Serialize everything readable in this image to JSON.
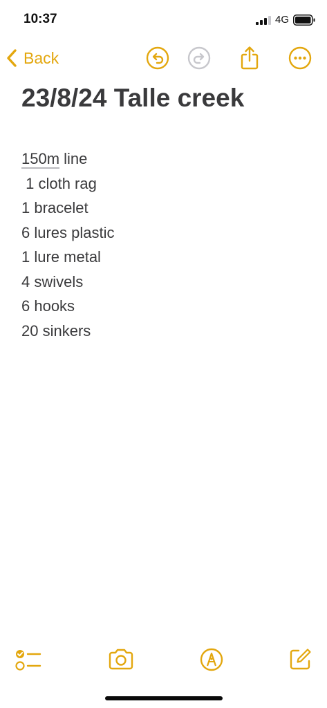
{
  "status_bar": {
    "time": "10:37",
    "network": "4G",
    "signal_bars_active": 3,
    "signal_bars_total": 4
  },
  "toolbar": {
    "back_label": "Back",
    "icons": {
      "undo": "undo-icon",
      "redo": "redo-icon",
      "share": "share-icon",
      "more": "more-icon"
    },
    "redo_enabled": false
  },
  "note": {
    "title": "23/8/24 Talle creek",
    "lines": [
      {
        "prefix": "150m",
        "text": " line"
      },
      {
        "prefix": "",
        "text": " 1 cloth rag"
      },
      {
        "prefix": "",
        "text": "1 bracelet"
      },
      {
        "prefix": "",
        "text": "6 lures plastic"
      },
      {
        "prefix": "",
        "text": "1 lure metal"
      },
      {
        "prefix": "",
        "text": "4 swivels"
      },
      {
        "prefix": "",
        "text": "6 hooks"
      },
      {
        "prefix": "",
        "text": "20 sinkers"
      }
    ]
  },
  "bottom_bar": {
    "icons": {
      "checklist": "checklist-icon",
      "camera": "camera-icon",
      "markup": "markup-pen-icon",
      "compose": "compose-icon"
    }
  },
  "colors": {
    "accent": "#E3A70E",
    "text": "#3a3a3c",
    "disabled": "#c7c7cc",
    "background": "#ffffff"
  }
}
